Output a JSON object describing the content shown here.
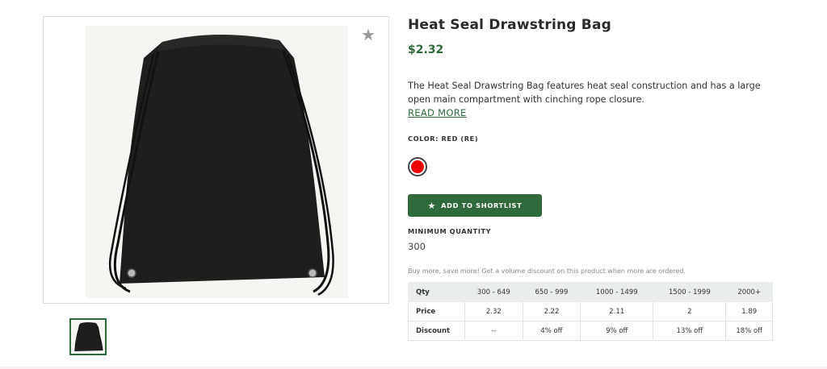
{
  "product": {
    "title": "Heat Seal Drawstring Bag",
    "price": "$2.32",
    "description": "The Heat Seal Drawstring Bag features heat seal construction and has a large open main compartment with cinching rope closure.",
    "read_more": "READ MORE"
  },
  "color": {
    "label": "COLOR: RED (RE)",
    "swatch_color": "#ee0000"
  },
  "shortlist": {
    "label": "ADD TO SHORTLIST",
    "icon": "star-icon"
  },
  "favorite": {
    "icon": "star-icon",
    "color": "#9a9a9a"
  },
  "minimum_quantity": {
    "label": "MINIMUM QUANTITY",
    "value": "300"
  },
  "discount_note": "Buy more, save more! Get a volume discount on this product when more are ordered.",
  "pricing_table": {
    "headers": [
      "Qty",
      "300 - 649",
      "650 - 999",
      "1000 - 1499",
      "1500 - 1999",
      "2000+"
    ],
    "rows": [
      [
        "Price",
        "2.32",
        "2.22",
        "2.11",
        "2",
        "1.89"
      ],
      [
        "Discount",
        "--",
        "4% off",
        "9% off",
        "13% off",
        "18% off"
      ]
    ]
  },
  "colors": {
    "accent": "#2f6a3d",
    "bag": "#1e1d1b"
  }
}
